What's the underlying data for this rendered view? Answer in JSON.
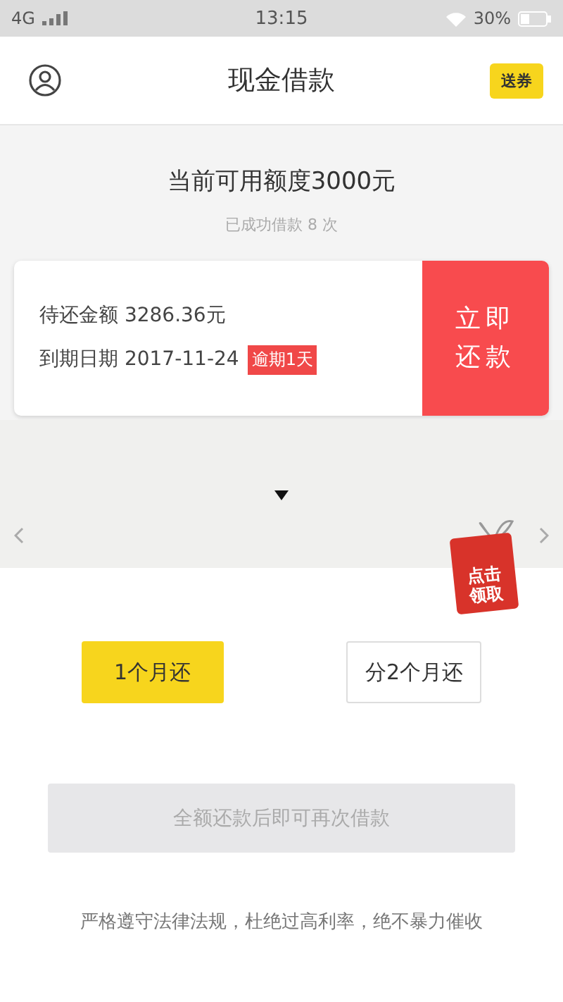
{
  "status_bar": {
    "network": "4G",
    "time": "13:15",
    "battery": "30%"
  },
  "header": {
    "title": "现金借款",
    "coupon": "送券"
  },
  "credit": {
    "available": "当前可用额度3000元",
    "history": "已成功借款 8 次"
  },
  "loan_card": {
    "amount": "待还金额 3286.36元",
    "due": "到期日期 2017-11-24",
    "overdue": "逾期1天",
    "repay_button": "立即还款"
  },
  "gift_badge": {
    "text": "点击领取"
  },
  "terms": [
    {
      "label": "1个月还",
      "selected": true
    },
    {
      "label": "分2个月还",
      "selected": false
    }
  ],
  "submit": {
    "label": "全额还款后即可再次借款",
    "disabled": true
  },
  "footer": "严格遵守法律法规，杜绝过高利率，绝不暴力催收"
}
